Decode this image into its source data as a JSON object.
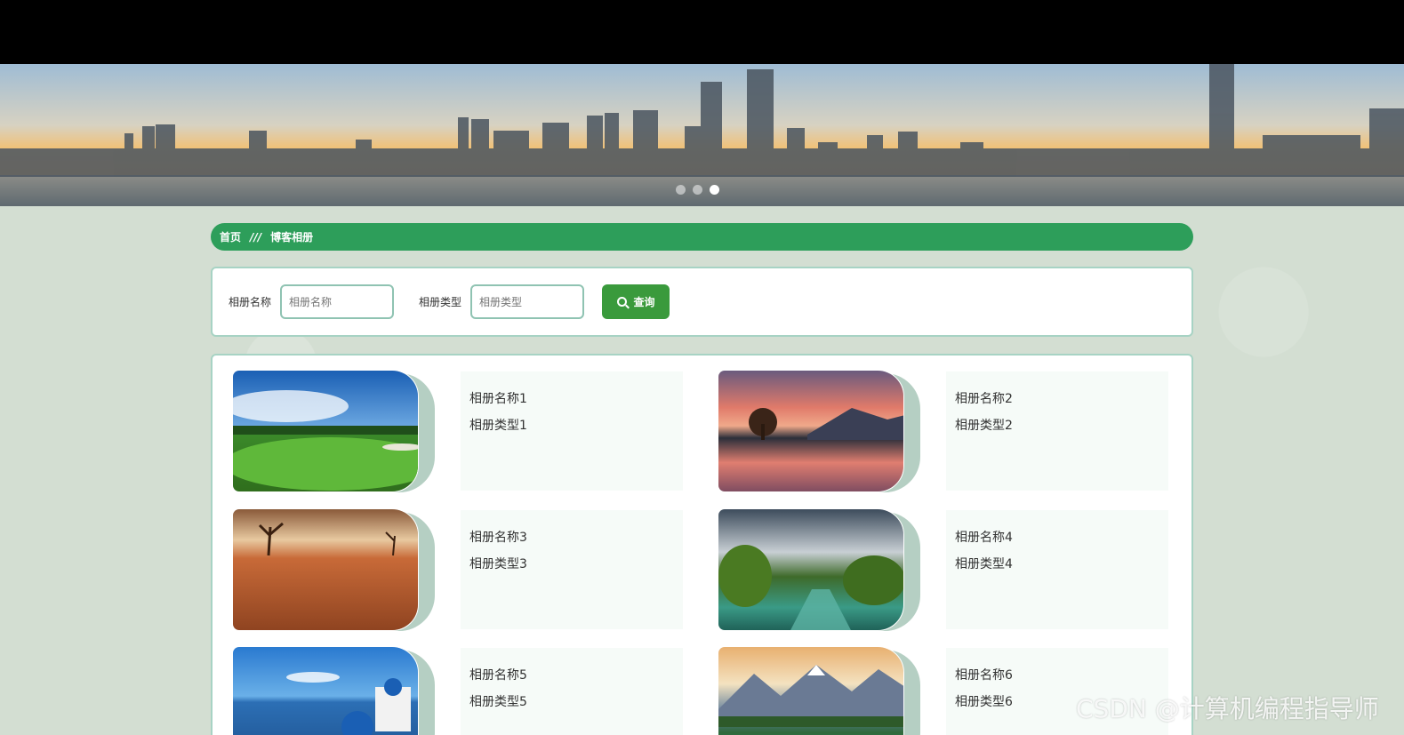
{
  "banner": {
    "slides": 3,
    "active_slide": 3
  },
  "breadcrumb": {
    "home": "首页",
    "separator": "///",
    "current": "博客相册"
  },
  "search": {
    "name_label": "相册名称",
    "name_placeholder": "相册名称",
    "type_label": "相册类型",
    "type_placeholder": "相册类型",
    "button_label": "查询"
  },
  "albums": [
    {
      "name": "相册名称1",
      "type": "相册类型1",
      "image": "golf-course"
    },
    {
      "name": "相册名称2",
      "type": "相册类型2",
      "image": "sunset-lake"
    },
    {
      "name": "相册名称3",
      "type": "相册类型3",
      "image": "desert"
    },
    {
      "name": "相册名称4",
      "type": "相册类型4",
      "image": "forest-river"
    },
    {
      "name": "相册名称5",
      "type": "相册类型5",
      "image": "santorini"
    },
    {
      "name": "相册名称6",
      "type": "相册类型6",
      "image": "mountain-lake"
    }
  ],
  "watermark": "CSDN @计算机编程指导师"
}
